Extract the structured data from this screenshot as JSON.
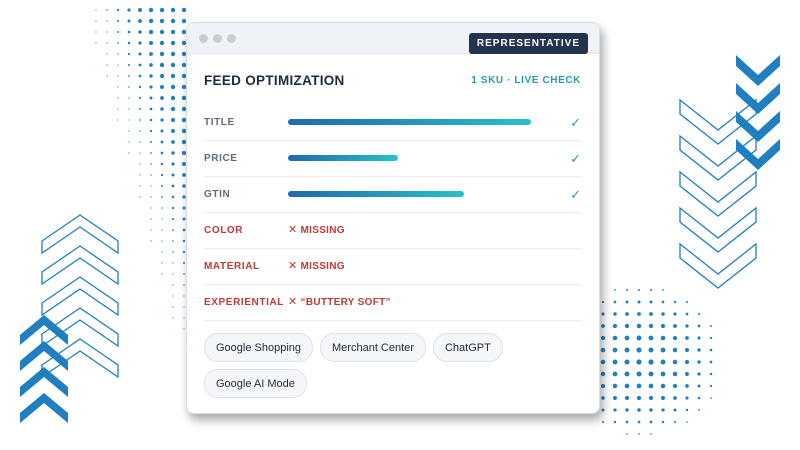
{
  "window": {
    "badge": "REPRESENTATIVE"
  },
  "panel": {
    "title": "FEED OPTIMIZATION",
    "meta": "1 SKU · LIVE CHECK"
  },
  "attributes": [
    {
      "label": "TITLE",
      "status": "ok",
      "completeness": 0.99,
      "check": "✓"
    },
    {
      "label": "PRICE",
      "status": "ok",
      "completeness": 0.45,
      "check": "✓"
    },
    {
      "label": "GTIN",
      "status": "ok",
      "completeness": 0.72,
      "check": "✓"
    }
  ],
  "issues": [
    {
      "label": "COLOR",
      "icon": "x-icon",
      "message": "MISSING"
    },
    {
      "label": "MATERIAL",
      "icon": "x-icon",
      "message": "MISSING"
    },
    {
      "label": "EXPERIENTIAL",
      "icon": "x-icon",
      "message": "“BUTTERY SOFT”"
    }
  ],
  "channels": [
    "Google Shopping",
    "Merchant Center",
    "ChatGPT",
    "Google AI Mode"
  ],
  "colors": {
    "navy": "#23324f",
    "teal": "#2a9aab",
    "error": "#bd3a34",
    "bar_start": "#1f6aa9",
    "bar_end": "#27c1c7",
    "decor_blue": "#1f7fc0"
  }
}
